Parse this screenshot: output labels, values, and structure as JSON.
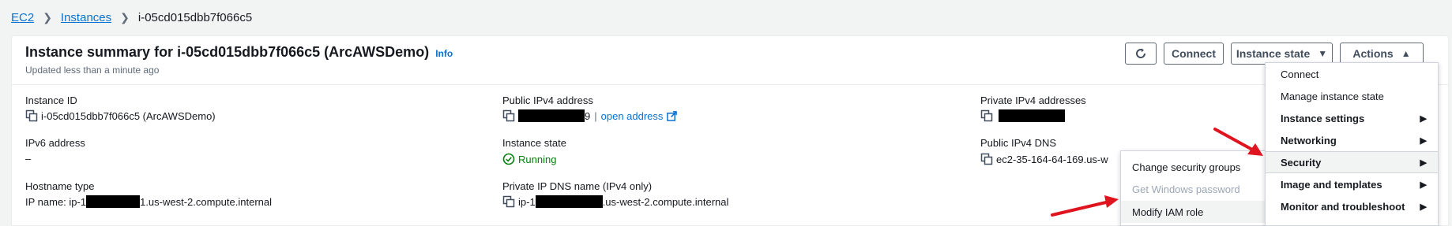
{
  "breadcrumb": {
    "root": "EC2",
    "parent": "Instances",
    "current": "i-05cd015dbb7f066c5"
  },
  "summary": {
    "title": "Instance summary for i-05cd015dbb7f066c5 (ArcAWSDemo)",
    "info_label": "Info",
    "subtitle": "Updated less than a minute ago"
  },
  "toolbar": {
    "refresh_icon": "refresh-icon",
    "connect_label": "Connect",
    "instance_state_label": "Instance state",
    "actions_label": "Actions"
  },
  "fields": {
    "instance_id": {
      "label": "Instance ID",
      "value": "i-05cd015dbb7f066c5 (ArcAWSDemo)"
    },
    "ipv6": {
      "label": "IPv6 address",
      "value": "–"
    },
    "hostname_type": {
      "label": "Hostname type",
      "prefix": "IP name: ip-1",
      "suffix": "1.us-west-2.compute.internal"
    },
    "public_ipv4": {
      "label": "Public IPv4 address",
      "suffix": "9",
      "separator": "|",
      "link": "open address"
    },
    "instance_state": {
      "label": "Instance state",
      "value": "Running"
    },
    "private_dns": {
      "label": "Private IP DNS name (IPv4 only)",
      "prefix": "ip-1",
      "suffix": ".us-west-2.compute.internal"
    },
    "private_ipv4": {
      "label": "Private IPv4 addresses"
    },
    "public_dns": {
      "label": "Public IPv4 DNS",
      "value": "ec2-35-164-64-169.us-w"
    }
  },
  "actions_menu": {
    "items": [
      {
        "label": "Connect"
      },
      {
        "label": "Manage instance state"
      },
      {
        "label": "Instance settings"
      },
      {
        "label": "Networking"
      },
      {
        "label": "Security"
      },
      {
        "label": "Image and templates"
      },
      {
        "label": "Monitor and troubleshoot"
      }
    ]
  },
  "security_submenu": {
    "items": [
      {
        "label": "Change security groups"
      },
      {
        "label": "Get Windows password"
      },
      {
        "label": "Modify IAM role"
      }
    ]
  },
  "colors": {
    "link": "#0972d3",
    "running": "#037f0c",
    "annotation_arrow": "#e0141e"
  }
}
